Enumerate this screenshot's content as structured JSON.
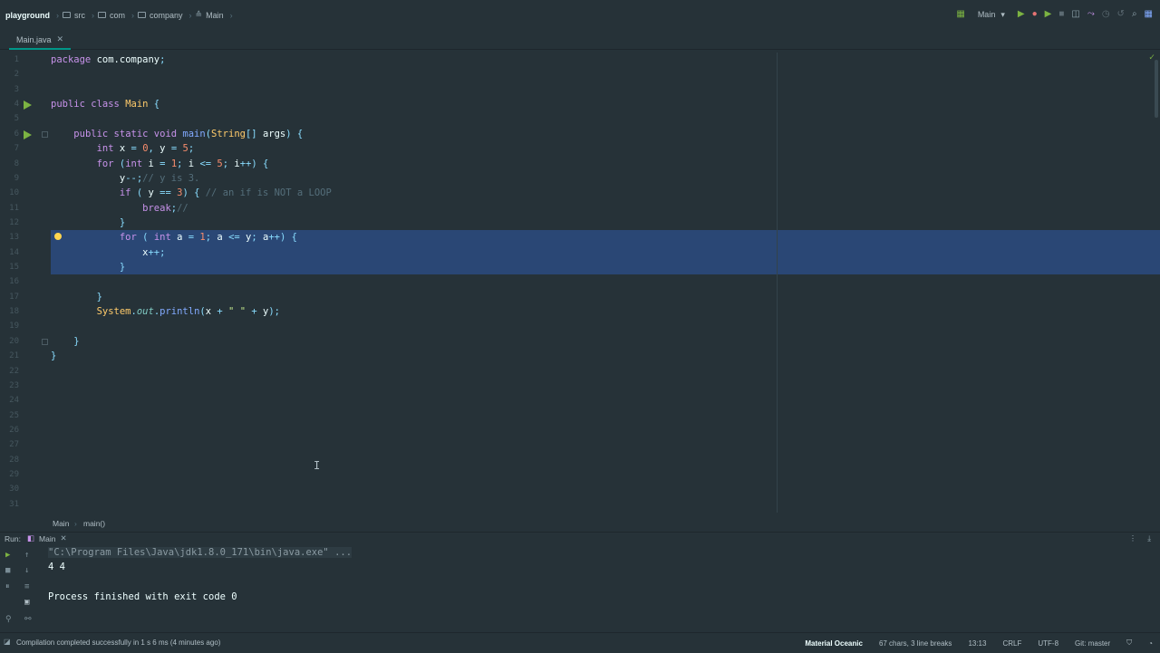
{
  "navbar": {
    "breadcrumbs": [
      "playground",
      "src",
      "com",
      "company",
      "Main"
    ],
    "run_config": "Main"
  },
  "tabs": [
    {
      "label": "Main.java"
    }
  ],
  "editor": {
    "line_numbers": [
      "1",
      "2",
      "3",
      "4",
      "5",
      "6",
      "7",
      "8",
      "9",
      "10",
      "11",
      "12",
      "13",
      "14",
      "15",
      "16",
      "17",
      "18",
      "19",
      "20",
      "21",
      "22",
      "23",
      "24",
      "25",
      "26",
      "27",
      "28",
      "29",
      "30",
      "31"
    ],
    "selected_lines": [
      13,
      14,
      15
    ],
    "lines": [
      {
        "n": 1,
        "tokens": [
          [
            "kw",
            "package"
          ],
          [
            "pl",
            " com.company"
          ],
          [
            "op",
            ";"
          ]
        ]
      },
      {
        "n": 2,
        "tokens": []
      },
      {
        "n": 3,
        "tokens": []
      },
      {
        "n": 4,
        "tokens": [
          [
            "kw",
            "public class "
          ],
          [
            "cls",
            "Main"
          ],
          [
            "op",
            " {"
          ]
        ]
      },
      {
        "n": 5,
        "tokens": []
      },
      {
        "n": 6,
        "tokens": [
          [
            "pl",
            "    "
          ],
          [
            "kw",
            "public static void "
          ],
          [
            "fn",
            "main"
          ],
          [
            "op",
            "("
          ],
          [
            "cls",
            "String"
          ],
          [
            "op",
            "[] "
          ],
          [
            "pl",
            "args"
          ],
          [
            "op",
            ") {"
          ]
        ]
      },
      {
        "n": 7,
        "tokens": [
          [
            "pl",
            "        "
          ],
          [
            "kw",
            "int "
          ],
          [
            "pl",
            "x "
          ],
          [
            "op",
            "= "
          ],
          [
            "num",
            "0"
          ],
          [
            "op",
            ", "
          ],
          [
            "pl",
            "y "
          ],
          [
            "op",
            "= "
          ],
          [
            "num",
            "5"
          ],
          [
            "op",
            ";"
          ]
        ]
      },
      {
        "n": 8,
        "tokens": [
          [
            "pl",
            "        "
          ],
          [
            "kw",
            "for "
          ],
          [
            "op",
            "("
          ],
          [
            "kw",
            "int "
          ],
          [
            "pl",
            "i "
          ],
          [
            "op",
            "= "
          ],
          [
            "num",
            "1"
          ],
          [
            "op",
            "; "
          ],
          [
            "pl",
            "i "
          ],
          [
            "op",
            "<= "
          ],
          [
            "num",
            "5"
          ],
          [
            "op",
            "; "
          ],
          [
            "pl",
            "i"
          ],
          [
            "op",
            "++) {"
          ]
        ]
      },
      {
        "n": 9,
        "tokens": [
          [
            "pl",
            "            y"
          ],
          [
            "op",
            "--;"
          ],
          [
            "cm",
            "// y is 3."
          ]
        ]
      },
      {
        "n": 10,
        "tokens": [
          [
            "pl",
            "            "
          ],
          [
            "kw",
            "if "
          ],
          [
            "op",
            "( "
          ],
          [
            "pl",
            "y "
          ],
          [
            "op",
            "== "
          ],
          [
            "num",
            "3"
          ],
          [
            "op",
            ") { "
          ],
          [
            "cm",
            "// an if is NOT a LOOP"
          ]
        ]
      },
      {
        "n": 11,
        "tokens": [
          [
            "pl",
            "                "
          ],
          [
            "kw",
            "break"
          ],
          [
            "op",
            ";"
          ],
          [
            "cm",
            "//"
          ]
        ]
      },
      {
        "n": 12,
        "tokens": [
          [
            "pl",
            "            "
          ],
          [
            "op",
            "}"
          ]
        ]
      },
      {
        "n": 13,
        "tokens": [
          [
            "pl",
            "            "
          ],
          [
            "kw",
            "for "
          ],
          [
            "op",
            "( "
          ],
          [
            "kw",
            "int "
          ],
          [
            "pl",
            "a "
          ],
          [
            "op",
            "= "
          ],
          [
            "num",
            "1"
          ],
          [
            "op",
            "; "
          ],
          [
            "pl",
            "a "
          ],
          [
            "op",
            "<= "
          ],
          [
            "pl",
            "y"
          ],
          [
            "op",
            "; "
          ],
          [
            "pl",
            "a"
          ],
          [
            "op",
            "++) {"
          ]
        ]
      },
      {
        "n": 14,
        "tokens": [
          [
            "pl",
            "                x"
          ],
          [
            "op",
            "++;"
          ]
        ]
      },
      {
        "n": 15,
        "tokens": [
          [
            "pl",
            "            "
          ],
          [
            "op",
            "}"
          ]
        ]
      },
      {
        "n": 16,
        "tokens": []
      },
      {
        "n": 17,
        "tokens": [
          [
            "pl",
            "        "
          ],
          [
            "op",
            "}"
          ]
        ]
      },
      {
        "n": 18,
        "tokens": [
          [
            "pl",
            "        "
          ],
          [
            "cls",
            "System"
          ],
          [
            "op",
            "."
          ],
          [
            "it",
            "out"
          ],
          [
            "op",
            "."
          ],
          [
            "fn",
            "println"
          ],
          [
            "op",
            "("
          ],
          [
            "pl",
            "x "
          ],
          [
            "op",
            "+ "
          ],
          [
            "str",
            "\" \""
          ],
          [
            "op",
            " + "
          ],
          [
            "pl",
            "y"
          ],
          [
            "op",
            ");"
          ]
        ]
      },
      {
        "n": 19,
        "tokens": []
      },
      {
        "n": 20,
        "tokens": [
          [
            "pl",
            "    "
          ],
          [
            "op",
            "}"
          ]
        ]
      },
      {
        "n": 21,
        "tokens": [
          [
            "op",
            "}"
          ]
        ]
      }
    ]
  },
  "crumbbar": {
    "class_name": "Main",
    "method_name": "main()"
  },
  "run_panel": {
    "label": "Run:",
    "tab": "Main",
    "lines": [
      "\"C:\\Program Files\\Java\\jdk1.8.0_171\\bin\\java.exe\" ...",
      "4 4",
      "",
      "Process finished with exit code 0"
    ]
  },
  "status": {
    "message": "Compilation completed successfully in 1 s 6 ms (4 minutes ago)",
    "theme": "Material Oceanic",
    "chars": "67 chars, 3 line breaks",
    "position": "13:13",
    "line_sep": "CRLF",
    "encoding": "UTF-8",
    "git": "Git: master"
  },
  "colors": {
    "background": "#263238",
    "selection": "#2a4775",
    "keyword": "#c792ea",
    "number": "#f78c6c",
    "function": "#82aaff",
    "accent": "#009688"
  }
}
